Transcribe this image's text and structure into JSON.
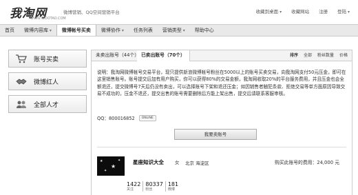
{
  "header": {
    "logo_text": "我淘网",
    "logo_sub": "WWW.WOOTAO.COM",
    "tagline": "微博营销、QQ空间营销平台",
    "links": [
      "收藏到桌面",
      "收藏网站",
      "注册",
      "登陆"
    ]
  },
  "nav": {
    "items": [
      "首页",
      "微博内容库",
      "微博帐号买卖",
      "微博协作",
      "任务列表",
      "营销类型",
      "帮助中心"
    ]
  },
  "sidebar": {
    "items": [
      {
        "label": "账号买卖",
        "icon": "cart-icon"
      },
      {
        "label": "微博红人",
        "icon": "handshake-icon"
      },
      {
        "label": "全部人才",
        "icon": "people-icon"
      }
    ]
  },
  "tabs": {
    "unsold": "未卖出账号（44个）",
    "sold": "已卖出账号（70个）"
  },
  "sort": {
    "label": "排序",
    "options": [
      "全部",
      "粉丝数量",
      "价格"
    ]
  },
  "description": {
    "text": "说明：我淘网微博帐号交易平台，现只提供新浪微博帐号粉丝在5000以上的账号买卖交易，向我淘网支付50元压金，即可在这里销售账号。账号提交后加有用户购买，你可以获得80%的交易金额，我淘网收取20%的平台服务费用，并且压金也会全额退还，提交微博号7天后仍没有卖出，可以选择账号下架和退还压金；如因销售者触犯条款、拒绝交易等单方面原因导致交易不成功的，压金不退还，提交出售的账号需要删除后方能上架出售，提交后请联系客服审核。",
    "qq_label": "QQ：",
    "qq_value": "800016852",
    "online_badge": "ONLINE"
  },
  "sell_button": "我要卖账号",
  "listing": {
    "name": "星座知识大全",
    "gender": "女",
    "location": "北京 海淀区",
    "price": "购买此账号的费用：24,000 元",
    "stats": [
      {
        "value": "1422",
        "label": "关注"
      },
      {
        "value": "80337",
        "label": "粉丝"
      },
      {
        "value": "181",
        "label": "微博"
      }
    ]
  }
}
